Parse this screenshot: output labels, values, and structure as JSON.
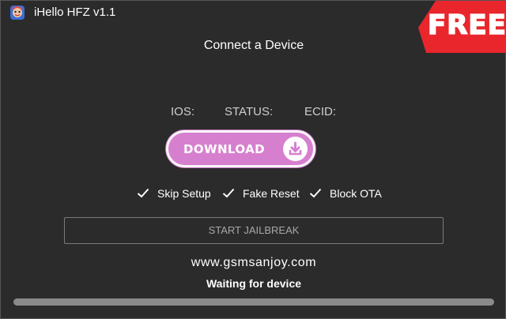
{
  "window": {
    "title": "iHello HFZ v1.1",
    "app_icon": "ihello-logo-icon"
  },
  "badge": {
    "text": "FREE",
    "color": "#e8262c"
  },
  "main": {
    "heading": "Connect a Device",
    "info_labels": [
      "IOS:",
      "STATUS:",
      "ECID:"
    ],
    "download_button": {
      "label": "DOWNLOAD",
      "icon": "download-icon",
      "color": "#d77fcf"
    },
    "options": [
      {
        "label": "Skip Setup",
        "checked": true
      },
      {
        "label": "Fake Reset",
        "checked": true
      },
      {
        "label": "Block OTA",
        "checked": true
      }
    ],
    "start_button": "START JAILBREAK",
    "website": "www.gsmsanjoy.com",
    "status_text": "Waiting for device",
    "progress": 0
  },
  "colors": {
    "background": "#2b2b2b",
    "text": "#ffffff",
    "muted_text": "#cfcfcf",
    "progress_track": "#8a8a8a"
  }
}
